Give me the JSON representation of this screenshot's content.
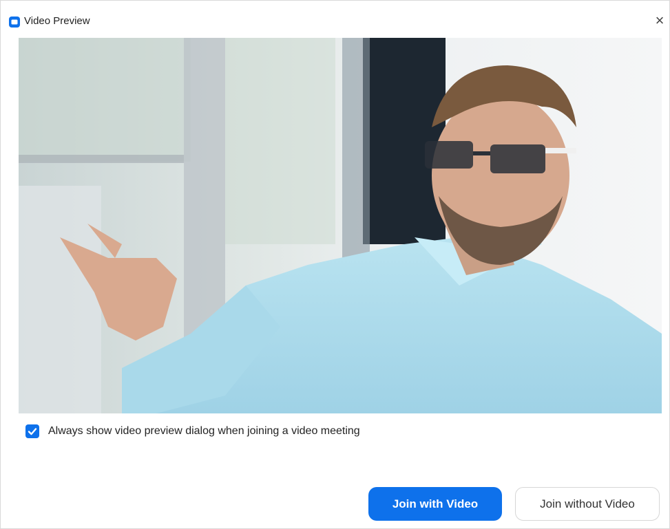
{
  "window": {
    "title": "Video Preview",
    "close_icon": "close-icon",
    "app_icon": "zoom-camera-icon"
  },
  "preview": {
    "checkbox_label": "Always show video preview dialog when joining a video meeting",
    "checkbox_checked": true
  },
  "actions": {
    "join_with_video": "Join with Video",
    "join_without_video": "Join without Video"
  },
  "colors": {
    "accent": "#0e71eb"
  }
}
